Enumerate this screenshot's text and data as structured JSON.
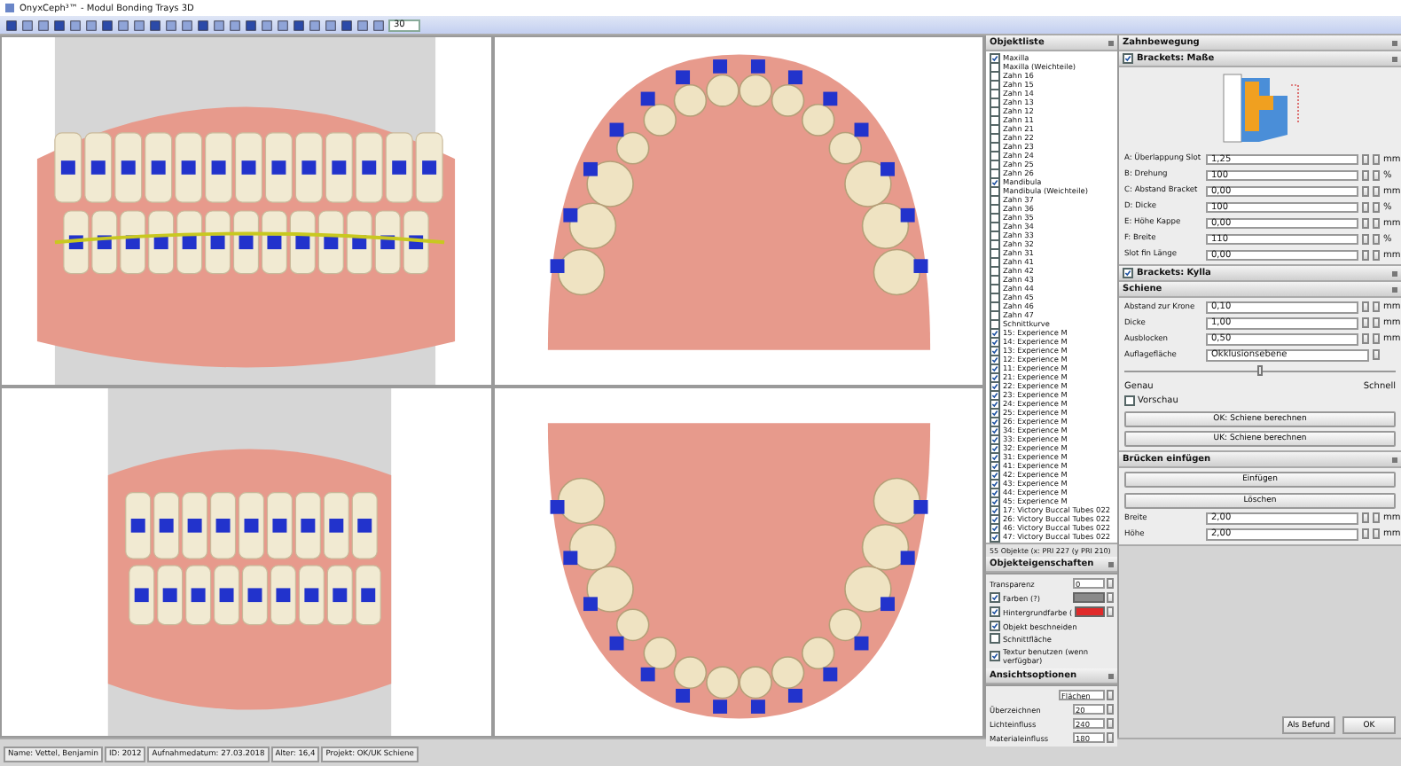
{
  "window": {
    "title": "OnyxCeph³™ - Modul Bonding Trays 3D"
  },
  "toolbar": {
    "zoom_value": "30"
  },
  "viewports": [
    {
      "kind": "front"
    },
    {
      "kind": "upper_occlusal"
    },
    {
      "kind": "side"
    },
    {
      "kind": "lower_occlusal"
    }
  ],
  "object_list": {
    "title": "Objektliste",
    "items": [
      {
        "label": "Maxilla",
        "checked": true
      },
      {
        "label": "Maxilla (Weichteile)",
        "checked": false
      },
      {
        "label": "Zahn 16",
        "checked": false
      },
      {
        "label": "Zahn 15",
        "checked": false
      },
      {
        "label": "Zahn 14",
        "checked": false
      },
      {
        "label": "Zahn 13",
        "checked": false
      },
      {
        "label": "Zahn 12",
        "checked": false
      },
      {
        "label": "Zahn 11",
        "checked": false
      },
      {
        "label": "Zahn 21",
        "checked": false
      },
      {
        "label": "Zahn 22",
        "checked": false
      },
      {
        "label": "Zahn 23",
        "checked": false
      },
      {
        "label": "Zahn 24",
        "checked": false
      },
      {
        "label": "Zahn 25",
        "checked": false
      },
      {
        "label": "Zahn 26",
        "checked": false
      },
      {
        "label": "Mandibula",
        "checked": true
      },
      {
        "label": "Mandibula (Weichteile)",
        "checked": false
      },
      {
        "label": "Zahn 37",
        "checked": false
      },
      {
        "label": "Zahn 36",
        "checked": false
      },
      {
        "label": "Zahn 35",
        "checked": false
      },
      {
        "label": "Zahn 34",
        "checked": false
      },
      {
        "label": "Zahn 33",
        "checked": false
      },
      {
        "label": "Zahn 32",
        "checked": false
      },
      {
        "label": "Zahn 31",
        "checked": false
      },
      {
        "label": "Zahn 41",
        "checked": false
      },
      {
        "label": "Zahn 42",
        "checked": false
      },
      {
        "label": "Zahn 43",
        "checked": false
      },
      {
        "label": "Zahn 44",
        "checked": false
      },
      {
        "label": "Zahn 45",
        "checked": false
      },
      {
        "label": "Zahn 46",
        "checked": false
      },
      {
        "label": "Zahn 47",
        "checked": false
      },
      {
        "label": "Schnittkurve",
        "checked": false
      },
      {
        "label": "15: Experience M",
        "checked": true
      },
      {
        "label": "14: Experience M",
        "checked": true
      },
      {
        "label": "13: Experience M",
        "checked": true
      },
      {
        "label": "12: Experience M",
        "checked": true
      },
      {
        "label": "11: Experience M",
        "checked": true
      },
      {
        "label": "21: Experience M",
        "checked": true
      },
      {
        "label": "22: Experience M",
        "checked": true
      },
      {
        "label": "23: Experience M",
        "checked": true
      },
      {
        "label": "24: Experience M",
        "checked": true
      },
      {
        "label": "25: Experience M",
        "checked": true
      },
      {
        "label": "26: Experience M",
        "checked": true
      },
      {
        "label": "34: Experience M",
        "checked": true
      },
      {
        "label": "33: Experience M",
        "checked": true
      },
      {
        "label": "32: Experience M",
        "checked": true
      },
      {
        "label": "31: Experience M",
        "checked": true
      },
      {
        "label": "41: Experience M",
        "checked": true
      },
      {
        "label": "42: Experience M",
        "checked": true
      },
      {
        "label": "43: Experience M",
        "checked": true
      },
      {
        "label": "44: Experience M",
        "checked": true
      },
      {
        "label": "45: Experience M",
        "checked": true
      },
      {
        "label": "17: Victory Buccal Tubes 022",
        "checked": true
      },
      {
        "label": "26: Victory Buccal Tubes 022",
        "checked": true
      },
      {
        "label": "46: Victory Buccal Tubes 022",
        "checked": true
      },
      {
        "label": "47: Victory Buccal Tubes 022",
        "checked": true
      }
    ],
    "footer": "55 Objekte (x: PRI 227 (y PRI 210)"
  },
  "object_properties": {
    "title": "Objekteigenschaften",
    "rows": [
      {
        "kind": "number",
        "label": "Transparenz",
        "value": "0"
      },
      {
        "kind": "color",
        "label": "Farben (?)",
        "checked": true,
        "color": "#8a8a8a"
      },
      {
        "kind": "color",
        "label": "Hintergrundfarbe (",
        "checked": true,
        "color": "#e02a2a"
      },
      {
        "kind": "checks",
        "items": [
          {
            "label": "Objekt beschneiden",
            "checked": true
          },
          {
            "label": "Schnittfläche",
            "checked": false
          }
        ]
      },
      {
        "kind": "checks",
        "items": [
          {
            "label": "Textur benutzen (wenn verfügbar)",
            "checked": true
          }
        ]
      }
    ]
  },
  "view_options": {
    "title": "Ansichtsoptionen",
    "mode": "Flächen",
    "fields": [
      {
        "label": "Überzeichnen",
        "value": "20"
      },
      {
        "label": "Lichteinfluss",
        "value": "240"
      },
      {
        "label": "Materialeinfluss",
        "value": "180"
      }
    ]
  },
  "tooth_movement": {
    "title": "Zahnbewegung"
  },
  "bracket_dimensions": {
    "title": "Brackets: Maße",
    "checked": true,
    "fields": [
      {
        "label": "A: Überlappung Slot",
        "value": "1,25",
        "unit": "mm"
      },
      {
        "label": "B: Drehung",
        "value": "100",
        "unit": "%"
      },
      {
        "label": "C: Abstand Bracket",
        "value": "0,00",
        "unit": "mm"
      },
      {
        "label": "D: Dicke",
        "value": "100",
        "unit": "%"
      },
      {
        "label": "E: Höhe Kappe",
        "value": "0,00",
        "unit": "mm"
      },
      {
        "label": "F: Breite",
        "value": "110",
        "unit": "%"
      },
      {
        "label": "Slot fin Länge",
        "value": "0,00",
        "unit": "mm"
      }
    ]
  },
  "bracket_kylla": {
    "title": "Brackets: Kylla",
    "checked": true
  },
  "splint": {
    "title": "Schiene",
    "fields": [
      {
        "label": "Abstand zur Krone",
        "value": "0,10",
        "unit": "mm"
      },
      {
        "label": "Dicke",
        "value": "1,00",
        "unit": "mm"
      },
      {
        "label": "Ausblocken",
        "value": "0,50",
        "unit": "mm"
      }
    ],
    "surface": {
      "label": "Auflagefläche",
      "value": "Okklusionsebene"
    },
    "slider": {
      "level": 0.5,
      "min_label": "Genau",
      "max_label": "Schnell"
    },
    "preview": {
      "label": "Vorschau",
      "checked": false
    },
    "buttons": [
      "OK: Schiene berechnen",
      "UK: Schiene berechnen"
    ]
  },
  "bridges": {
    "title": "Brücken einfügen",
    "buttons": [
      "Einfügen",
      "Löschen"
    ],
    "fields": [
      {
        "label": "Breite",
        "value": "2,00",
        "unit": "mm"
      },
      {
        "label": "Höhe",
        "value": "2,00",
        "unit": "mm"
      }
    ]
  },
  "footer_buttons": [
    "Als Befund",
    "OK"
  ],
  "status_bar": [
    "Name: Vettel, Benjamin",
    "ID: 2012",
    "Aufnahmedatum: 27.03.2018",
    "Alter: 16,4",
    "Projekt: OK/UK Schiene"
  ]
}
